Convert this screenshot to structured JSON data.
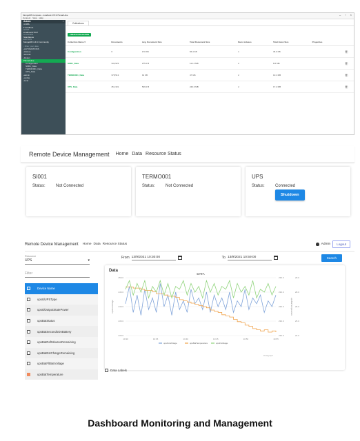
{
  "compass": {
    "title": "MongoDB Compass - localhost:27017/SmartHive",
    "menu": [
      "Connect",
      "View",
      "Help"
    ],
    "window_controls": [
      "–",
      "▫",
      "×"
    ],
    "sidebar": {
      "header": "Admin",
      "top_items": [
        {
          "key": "",
          "value": "4 DBS",
          "kind": "val"
        },
        {
          "key": "",
          "value": "▾ localhost",
          "kind": "val"
        },
        {
          "key": "HOST",
          "value": "localhost:27017",
          "kind": "kv"
        },
        {
          "key": "CLUSTER",
          "value": "Standalone",
          "kind": "kv"
        },
        {
          "key": "EDITION",
          "value": "MongoDB 4.4.6 Community",
          "kind": "kv"
        }
      ],
      "filter_placeholder": "Filter your data",
      "dbs": [
        "AUTOMATIONS",
        "History",
        "ROOM",
        "Rotary"
      ],
      "selected_db": "SmartHive",
      "collections": [
        "Configuration",
        "SI001_Data",
        "TERMO001_Data",
        "UPS_Data"
      ],
      "bottom_dbs": [
        "admin",
        "config",
        "local"
      ]
    },
    "tab": "Collections",
    "create_button": "CREATE COLLECTION",
    "columns": [
      "Collection Name ▾",
      "Documents",
      "Avg. Document Size",
      "Total Document Size",
      "Num. Indexes",
      "Total Index Size",
      "Properties",
      ""
    ],
    "rows": [
      [
        "Configuration",
        "6",
        "170 KB",
        "56.4 KB",
        "1",
        "36.0 KB",
        "",
        "🗑"
      ],
      [
        "SI001_Data",
        "332,923",
        "275.0 B",
        "112.4 MB",
        "2",
        "8.6 MB",
        "",
        "🗑"
      ],
      [
        "TERMO001_Data",
        "378,513",
        "91 KB",
        "47 GB",
        "2",
        "10.1 MB",
        "",
        "🗑"
      ],
      [
        "UPS_Data",
        "451,331",
        "539.0 B",
        "240.0 MB",
        "2",
        "17.2 MB",
        "",
        "🗑"
      ]
    ]
  },
  "rdm_cards": {
    "brand": "Remote Device Management",
    "nav": [
      "Home",
      "Data",
      "Resource Status"
    ],
    "cards": [
      {
        "title": "SI001",
        "status_label": "Status:",
        "status": "Not Connected"
      },
      {
        "title": "TERMO001",
        "status_label": "Status:",
        "status": "Not Connected"
      },
      {
        "title": "UPS",
        "status_label": "Status:",
        "status": "Connected",
        "button": "Shutdown"
      }
    ]
  },
  "dashboard": {
    "brand": "Remote Device Management",
    "nav": [
      "Home",
      "Data",
      "Resource Status"
    ],
    "user": "Admin",
    "logout": "Logout",
    "resource_label": "Resource",
    "resource_value": "UPS",
    "filter_placeholder": "Filter",
    "from_label": "From",
    "from_value": "13/9/2021 10:30:00",
    "to_label": "To",
    "to_value": "13/9/2021 10:59:00",
    "search_button": "Search",
    "variables_header": "Device Name",
    "variables": [
      {
        "name": "upsIdUPSType",
        "checked": false
      },
      {
        "name": "upsIdOutputStatePower",
        "checked": false
      },
      {
        "name": "upsBatStatus",
        "checked": false
      },
      {
        "name": "upsBatSecondsOnBattery",
        "checked": false
      },
      {
        "name": "upsBatRefMinutesRemaining",
        "checked": false
      },
      {
        "name": "upsBatEstChargeRemaining",
        "checked": false
      },
      {
        "name": "upsBatFltBatVoltage",
        "checked": false
      },
      {
        "name": "upsBatTemperature",
        "checked": true
      }
    ],
    "data_title": "Data",
    "data_labels": "Data Labels",
    "colors": {
      "series1": "#7fa3d9",
      "series2": "#f0a24a",
      "series3": "#8fd37a"
    }
  },
  "chart_data": {
    "type": "line",
    "title": "DATA",
    "x": [
      "10:30",
      "10:35",
      "10:40",
      "10:45",
      "10:50",
      "10:55"
    ],
    "left_axis_ticks": [
      "250.0",
      "245.0",
      "240.0",
      "235.0",
      "230.0"
    ],
    "mid_axis_ticks": [
      "230.0",
      "230.0",
      "230.0",
      "230.0",
      "230.0"
    ],
    "right_axis_ticks": [
      "29.0",
      "28.0",
      "26.0",
      "25.0",
      "24.0"
    ],
    "ylabel_left": "upsOutVoltage",
    "ylabel_right": "upsBatTemperature",
    "corner_label": "Datagraph",
    "series": [
      {
        "name": "upsOutVoltage",
        "axis": "left",
        "values": [
          241,
          247,
          238,
          244,
          237,
          246,
          239,
          243,
          238,
          248,
          240,
          244,
          237,
          245,
          239,
          242,
          238,
          246,
          241,
          243,
          239,
          245,
          238,
          244,
          240,
          243,
          239,
          245,
          238,
          242,
          240,
          246,
          239,
          243,
          241,
          244,
          238,
          242,
          240,
          244
        ]
      },
      {
        "name": "upsBatTemperature",
        "axis": "right",
        "values": [
          28.2,
          28.2,
          28.1,
          28.1,
          28.0,
          27.9,
          27.9,
          27.8,
          27.6,
          27.6,
          27.5,
          27.4,
          27.4,
          27.3,
          27.1,
          27.0,
          26.9,
          26.8,
          26.7,
          26.6,
          26.5,
          26.4,
          26.2,
          26.1,
          26.0,
          25.8,
          25.7,
          25.6,
          25.4,
          25.2,
          25.1,
          24.9,
          24.8,
          24.6,
          24.5,
          24.4,
          24.5,
          24.3,
          24.4,
          24.3
        ]
      },
      {
        "name": "upsInVoltage",
        "axis": "left",
        "values": [
          246,
          249,
          244,
          248,
          245,
          249,
          243,
          247,
          245,
          249,
          244,
          248,
          243,
          247,
          246,
          249,
          244,
          248,
          245,
          247,
          243,
          249,
          245,
          248,
          244,
          247,
          246,
          249,
          243,
          248,
          245,
          247,
          244,
          249,
          243,
          246,
          245,
          248,
          244,
          247
        ]
      }
    ]
  },
  "caption": "Dashboard Monitoring and Management"
}
